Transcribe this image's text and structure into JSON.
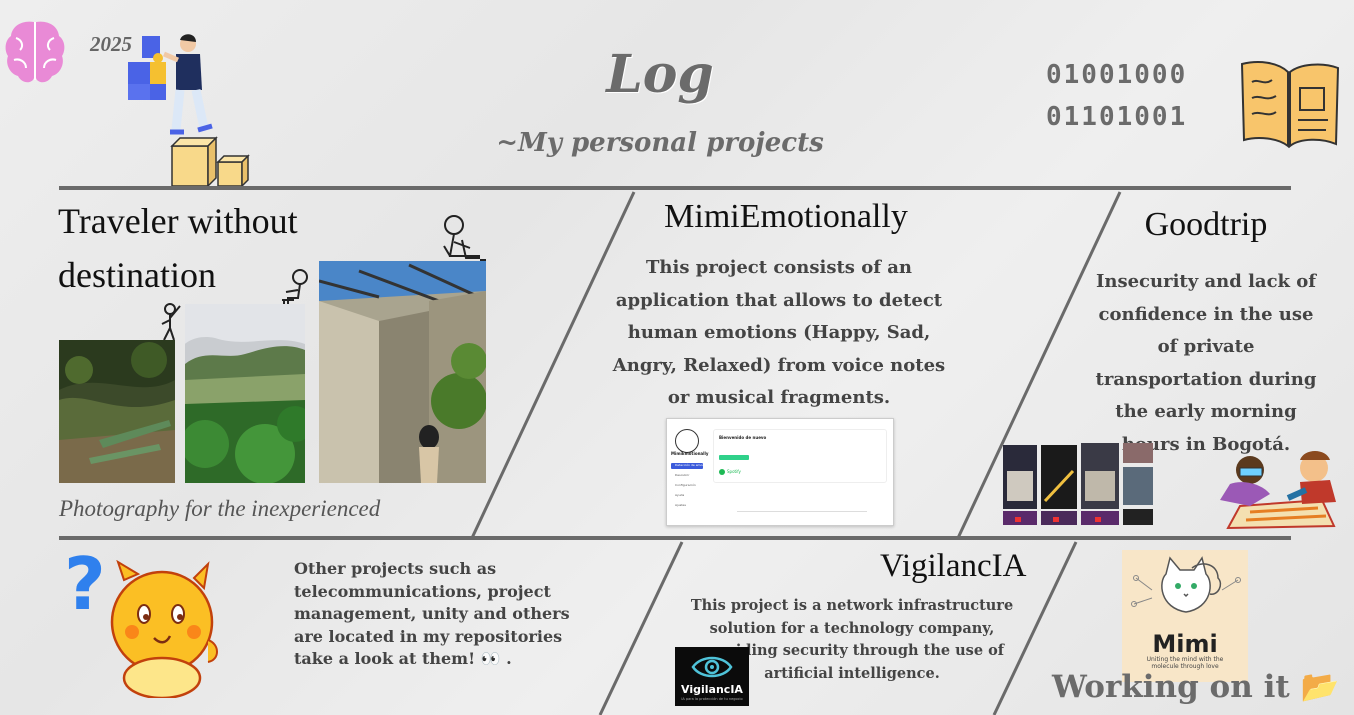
{
  "header": {
    "year": "2025",
    "title": "Log",
    "subtitle": "~My personal projects",
    "binary": [
      "01001000",
      "01101001"
    ]
  },
  "traveler": {
    "title_line1": "Traveler without",
    "title_line2": "destination",
    "caption": "Photography for the inexperienced"
  },
  "mimi_emotionally": {
    "title": "MimiEmotionally",
    "description": "This project consists of an application that allows to detect human emotions (Happy, Sad, Angry, Relaxed) from voice notes or musical fragments.",
    "app_screenshot": {
      "brand": "MimiEmotionally",
      "menu_items": [
        "Detección de emoción",
        "Descubrir",
        "Configuración",
        "Ayuda",
        "Ajustes"
      ],
      "welcome": "Bienvenido de nuevo",
      "spotify_label": "Spotify"
    }
  },
  "goodtrip": {
    "title": "Goodtrip",
    "description": "Insecurity and lack of confidence in the use of private transportation during the early morning hours in Bogotá."
  },
  "other": {
    "text_prefix": "Other projects such as telecommunications, project management, unity and others are located in my repositories take a look at them! ",
    "emoji": "👀",
    "text_suffix": " ."
  },
  "vigilancia": {
    "title": "VigilancIA",
    "description": "This project is a network infrastructure solution for a technology company, providing security through the use of artificial intelligence.",
    "logo_text": "VigilancIA",
    "logo_sub": "IA para la protección de tu negocio"
  },
  "mimi": {
    "logo_text": "Mimi",
    "tagline": "Uniting the mind with the molecule through love"
  },
  "working": {
    "label": "Working on it",
    "emoji": "📂"
  },
  "colors": {
    "divider": "#6a6a6a",
    "brain": "#e98ad6",
    "puzzle_blue": "#4a63e6",
    "puzzle_yellow": "#f5c030",
    "box_yellow": "#f8d98a",
    "duck_yellow": "#fbbf24",
    "question_blue": "#2f80ed"
  }
}
